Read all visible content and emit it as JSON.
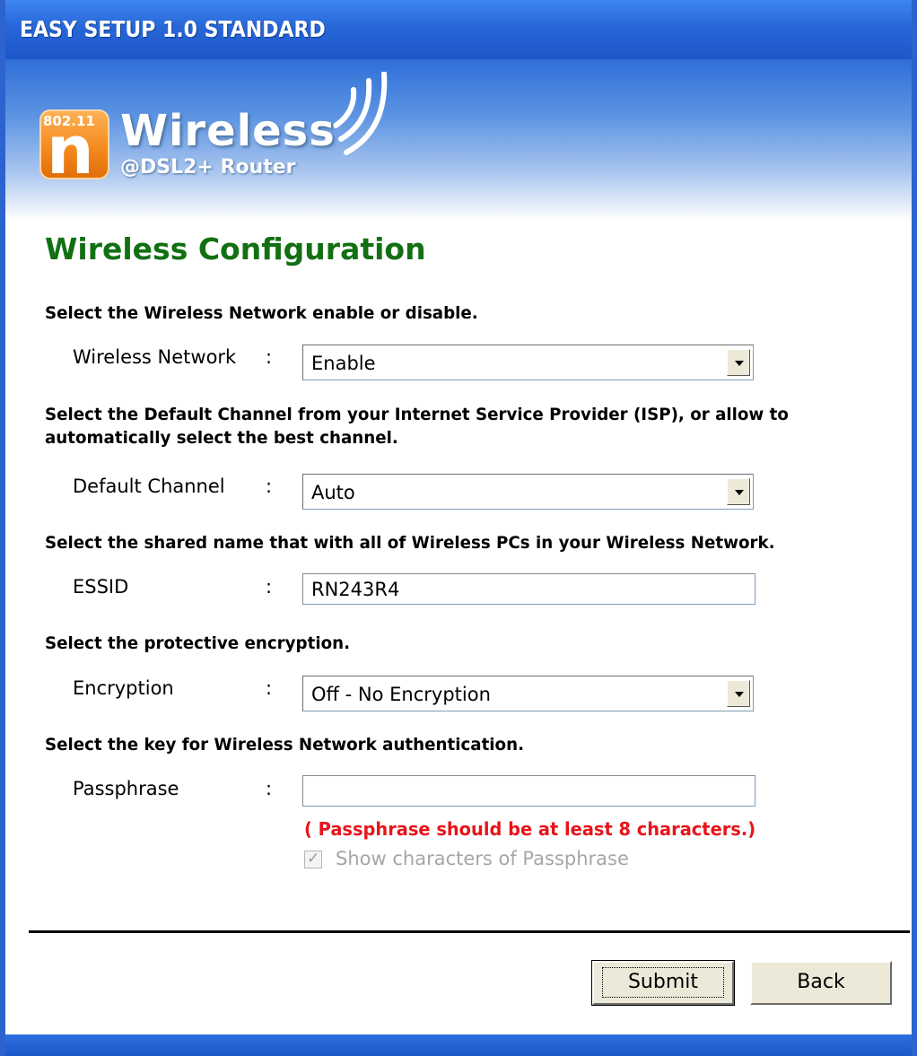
{
  "window": {
    "title": "EASY SETUP 1.0 STANDARD"
  },
  "logo": {
    "badge_tag": "802.11",
    "badge_letter": "n",
    "name": "Wireless",
    "subtitle": "@DSL2+ Router"
  },
  "heading": "Wireless Configuration",
  "sections": {
    "network": {
      "instruction": "Select the Wireless Network enable or disable.",
      "label": "Wireless Network",
      "colon": ":",
      "value": "Enable"
    },
    "channel": {
      "instruction_line1": "Select the Default Channel from your Internet Service Provider (ISP),  or allow to",
      "instruction_line2": "automatically select the best channel.",
      "label": "Default Channel",
      "colon": ":",
      "value": "Auto"
    },
    "essid": {
      "instruction": "Select the shared name that with all of Wireless PCs in your Wireless Network.",
      "label": "ESSID",
      "colon": ":",
      "value": "RN243R4"
    },
    "encryption": {
      "instruction": "Select the protective encryption.",
      "label": "Encryption",
      "colon": ":",
      "value": "Off - No Encryption"
    },
    "passphrase": {
      "instruction": "Select the key for Wireless Network authentication.",
      "label": "Passphrase",
      "colon": ":",
      "value": "",
      "warning": "( Passphrase should be at least 8 characters.)",
      "show_checkbox_label": "Show characters of Passphrase",
      "show_checked": true,
      "show_enabled": false
    }
  },
  "buttons": {
    "submit": "Submit",
    "back": "Back"
  },
  "colors": {
    "titlebar": "#2867d8",
    "heading": "#127012",
    "warning": "#e8141a",
    "disabled_text": "#a6a6a6"
  }
}
